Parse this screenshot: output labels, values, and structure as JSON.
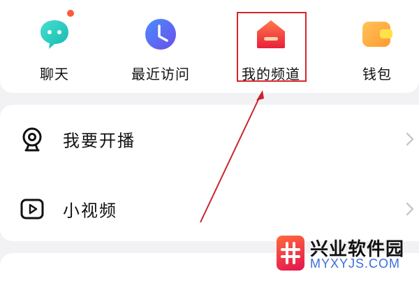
{
  "quick_actions": [
    {
      "label": "聊天",
      "icon": "chat-bubble-icon",
      "badge_dot": true
    },
    {
      "label": "最近访问",
      "icon": "clock-icon"
    },
    {
      "label": "我的频道",
      "icon": "home-channel-icon"
    },
    {
      "label": "钱包",
      "icon": "wallet-icon"
    }
  ],
  "menu": [
    {
      "label": "我要开播",
      "icon": "camera-icon"
    },
    {
      "label": "小视频",
      "icon": "play-video-icon"
    }
  ],
  "watermark": {
    "title": "兴业软件园",
    "url": "MYXYJS.COM"
  },
  "colors": {
    "highlight": "#d8242b",
    "chat": "#2fd1c2",
    "clock": "#5b6cf5",
    "channel": "#f04a3c",
    "wallet": "#ffb43b"
  }
}
